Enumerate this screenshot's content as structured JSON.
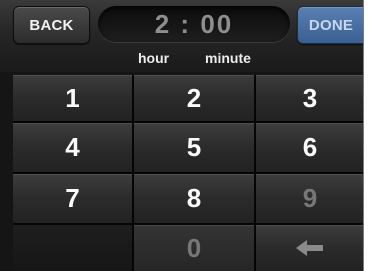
{
  "header": {
    "back_label": "BACK",
    "done_label": "DONE",
    "time_value": "2 : 00",
    "hour_label": "hour",
    "minute_label": "minute"
  },
  "keypad": {
    "k1": "1",
    "k2": "2",
    "k3": "3",
    "k4": "4",
    "k5": "5",
    "k6": "6",
    "k7": "7",
    "k8": "8",
    "k9": "9",
    "k0": "0",
    "backspace_icon": "backspace-arrow-icon"
  },
  "colors": {
    "background": "#151515",
    "done_button": "#4a6fa3",
    "key_text": "#fafafa",
    "disabled_key_text": "#777777"
  }
}
